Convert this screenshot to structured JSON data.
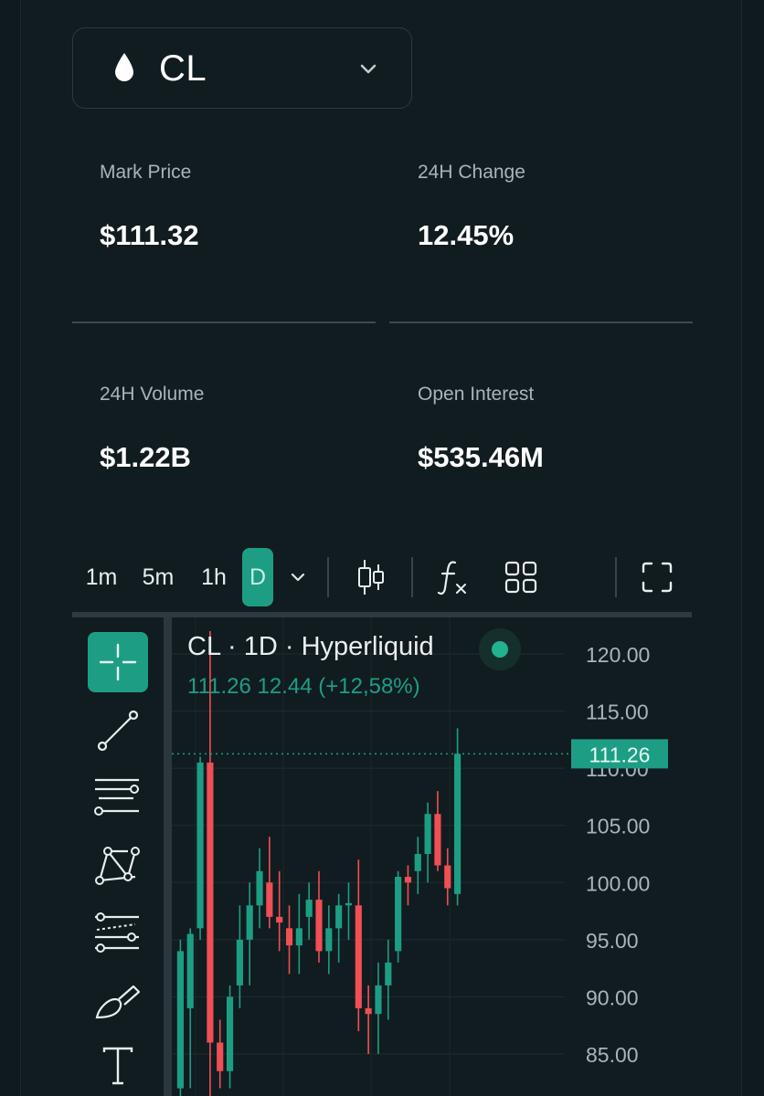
{
  "market": {
    "symbol": "CL",
    "icon": "droplet-icon"
  },
  "stats": {
    "mark_price": {
      "label": "Mark Price",
      "value": "$111.32"
    },
    "change_24h": {
      "label": "24H Change",
      "value": "12.45%"
    },
    "volume_24h": {
      "label": "24H Volume",
      "value": "$1.22B"
    },
    "open_interest": {
      "label": "Open Interest",
      "value": "$535.46M"
    }
  },
  "toolbar": {
    "intervals": [
      "1m",
      "5m",
      "1h",
      "D"
    ],
    "active_interval": "D"
  },
  "chart": {
    "title": "CL  · 1D · Hyperliquid",
    "ohlc_line": "111.26  12.44 (+12,58%)",
    "price_tag": "111.26",
    "colors": {
      "up": "#1d9e84",
      "down": "#ef4f55",
      "accent": "#1d9e84"
    }
  },
  "chart_data": {
    "type": "candlestick",
    "y_ticks": [
      "120.00",
      "115.00",
      "110.00",
      "105.00",
      "100.00",
      "95.00",
      "90.00",
      "85.00"
    ],
    "ylim": [
      82,
      123
    ],
    "last_price": 111.26,
    "candles": [
      {
        "o": 82.0,
        "h": 95.0,
        "l": 80.0,
        "c": 94.0
      },
      {
        "o": 89.0,
        "h": 96.0,
        "l": 82.0,
        "c": 95.5
      },
      {
        "o": 96.0,
        "h": 111.0,
        "l": 95.0,
        "c": 110.5
      },
      {
        "o": 110.5,
        "h": 122.0,
        "l": 80.0,
        "c": 86.0
      },
      {
        "o": 86.0,
        "h": 88.0,
        "l": 82.0,
        "c": 83.5
      },
      {
        "o": 83.5,
        "h": 91.0,
        "l": 82.0,
        "c": 90.0
      },
      {
        "o": 91.0,
        "h": 98.0,
        "l": 89.0,
        "c": 95.0
      },
      {
        "o": 95.0,
        "h": 100.0,
        "l": 91.0,
        "c": 98.0
      },
      {
        "o": 98.0,
        "h": 103.0,
        "l": 96.0,
        "c": 101.0
      },
      {
        "o": 100.0,
        "h": 104.0,
        "l": 96.0,
        "c": 97.0
      },
      {
        "o": 97.0,
        "h": 101.0,
        "l": 94.0,
        "c": 96.5
      },
      {
        "o": 96.0,
        "h": 98.0,
        "l": 92.0,
        "c": 94.5
      },
      {
        "o": 94.5,
        "h": 99.0,
        "l": 92.0,
        "c": 96.0
      },
      {
        "o": 97.0,
        "h": 100.0,
        "l": 95.0,
        "c": 98.5
      },
      {
        "o": 98.5,
        "h": 101.0,
        "l": 93.0,
        "c": 94.0
      },
      {
        "o": 94.0,
        "h": 98.0,
        "l": 92.0,
        "c": 96.0
      },
      {
        "o": 96.0,
        "h": 99.0,
        "l": 93.0,
        "c": 98.0
      },
      {
        "o": 98.0,
        "h": 100.0,
        "l": 95.0,
        "c": 98.2
      },
      {
        "o": 98.0,
        "h": 102.0,
        "l": 87.0,
        "c": 89.0
      },
      {
        "o": 89.0,
        "h": 91.0,
        "l": 85.0,
        "c": 88.5
      },
      {
        "o": 88.5,
        "h": 93.0,
        "l": 85.0,
        "c": 91.0
      },
      {
        "o": 91.0,
        "h": 95.0,
        "l": 88.0,
        "c": 93.0
      },
      {
        "o": 94.0,
        "h": 101.0,
        "l": 93.0,
        "c": 100.5
      },
      {
        "o": 100.5,
        "h": 101.5,
        "l": 98.0,
        "c": 100.0
      },
      {
        "o": 101.0,
        "h": 104.0,
        "l": 99.0,
        "c": 102.5
      },
      {
        "o": 102.5,
        "h": 107.0,
        "l": 100.0,
        "c": 106.0
      },
      {
        "o": 106.0,
        "h": 108.0,
        "l": 101.0,
        "c": 101.5
      },
      {
        "o": 101.5,
        "h": 103.0,
        "l": 98.0,
        "c": 99.5
      },
      {
        "o": 99.0,
        "h": 113.5,
        "l": 98.0,
        "c": 111.26
      }
    ]
  },
  "sidebar_tools": [
    "crosshair-icon",
    "trendline-icon",
    "horizontal-lines-icon",
    "pattern-icon",
    "projection-icon",
    "brush-icon",
    "text-icon"
  ]
}
